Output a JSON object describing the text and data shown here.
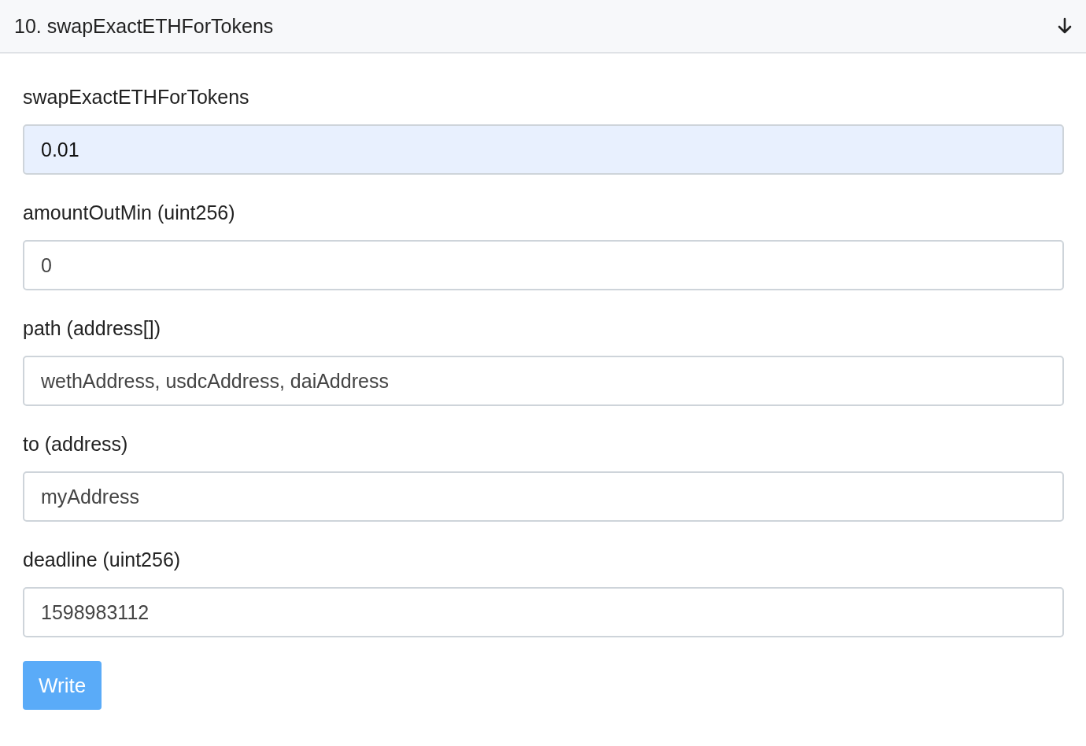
{
  "header": {
    "title": "10. swapExactETHForTokens",
    "expanded": true
  },
  "fields": [
    {
      "label": "swapExactETHForTokens",
      "value": "0.01",
      "autofilled": true
    },
    {
      "label": "amountOutMin (uint256)",
      "value": "0",
      "autofilled": false
    },
    {
      "label": "path (address[])",
      "value": "wethAddress, usdcAddress, daiAddress",
      "autofilled": false
    },
    {
      "label": "to (address)",
      "value": "myAddress",
      "autofilled": false
    },
    {
      "label": "deadline (uint256)",
      "value": "1598983112",
      "autofilled": false
    }
  ],
  "button": {
    "label": "Write"
  }
}
